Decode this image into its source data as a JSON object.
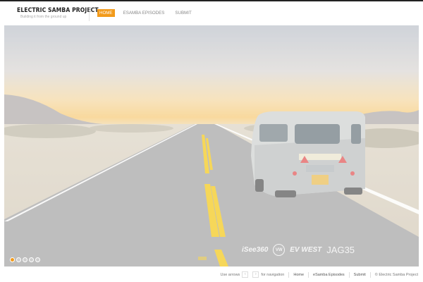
{
  "site": {
    "title": "ELECTRIC SAMBA PROJECT",
    "tagline": "Building it from the ground up"
  },
  "nav": {
    "items": [
      {
        "label": "HOME",
        "active": true
      },
      {
        "label": "ESAMBA EPISODES",
        "active": false
      },
      {
        "label": "SUBMIT",
        "active": false
      }
    ]
  },
  "hero": {
    "image": "desert-road-vw-bus",
    "slide_count": 5,
    "active_slide": 1,
    "sponsors": [
      "iSee360",
      "VW",
      "EV WEST",
      "JAG35"
    ]
  },
  "footer": {
    "use_arrows": "Use arrows",
    "arrow_left": "‹",
    "arrow_right": "›",
    "for_navigation": "for navigation",
    "links": [
      "Home",
      "eSamba Episodes",
      "Submit"
    ],
    "copyright": "© Electric Samba Project"
  },
  "colors": {
    "accent": "#f29a1a",
    "topbar": "#222222"
  }
}
